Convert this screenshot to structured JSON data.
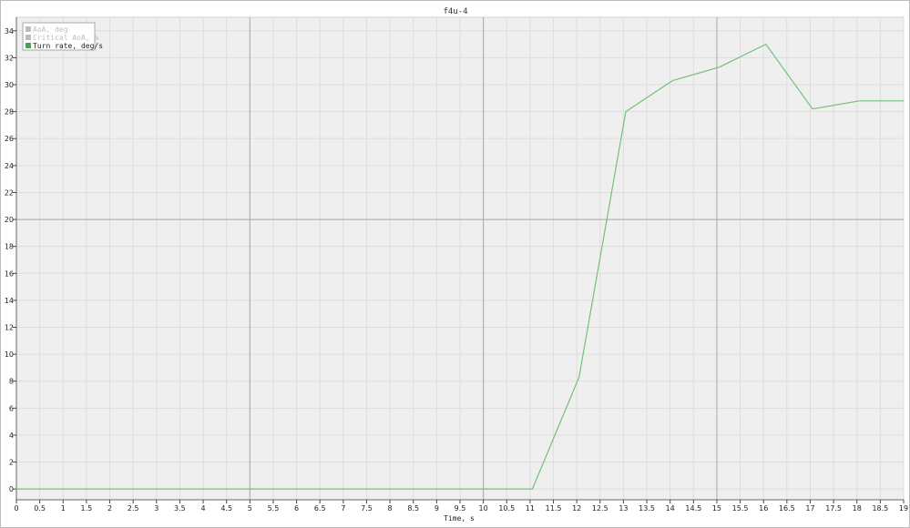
{
  "chart_data": {
    "type": "line",
    "title": "f4u-4",
    "xlabel": "Time, s",
    "ylabel": "",
    "xlim": [
      0,
      19
    ],
    "ylim": [
      -0.8,
      35
    ],
    "x_ticks": [
      0,
      0.5,
      1,
      1.5,
      2,
      2.5,
      3,
      3.5,
      4,
      4.5,
      5,
      5.5,
      6,
      6.5,
      7,
      7.5,
      8,
      8.5,
      9,
      9.5,
      10,
      10.5,
      11,
      11.5,
      12,
      12.5,
      13,
      13.5,
      14,
      14.5,
      15,
      15.5,
      16,
      16.5,
      17,
      17.5,
      18,
      18.5,
      19
    ],
    "y_ticks": [
      0,
      2,
      4,
      6,
      8,
      10,
      12,
      14,
      16,
      18,
      20,
      22,
      24,
      26,
      28,
      30,
      32,
      34
    ],
    "major_x_gridlines": [
      5,
      10,
      15
    ],
    "major_y_gridlines": [
      20
    ],
    "grid": true,
    "legend_position": "top-left",
    "legend": [
      {
        "label": "AoA, deg",
        "color": "#bdbdbd",
        "active": false
      },
      {
        "label": "Critical AoA, %",
        "color": "#bdbdbd",
        "active": false
      },
      {
        "label": "Turn rate, deg/s",
        "color": "#4f9f58",
        "active": true
      }
    ],
    "series": [
      {
        "name": "Turn rate, deg/s",
        "color": "#73c07b",
        "x": [
          0,
          5,
          10,
          11.05,
          12.05,
          13.05,
          14.05,
          15.05,
          16.05,
          17.05,
          18.05,
          19
        ],
        "values": [
          0,
          0,
          0,
          0,
          8.3,
          28.0,
          30.3,
          31.3,
          33.0,
          28.2,
          28.8,
          28.8
        ]
      }
    ]
  }
}
